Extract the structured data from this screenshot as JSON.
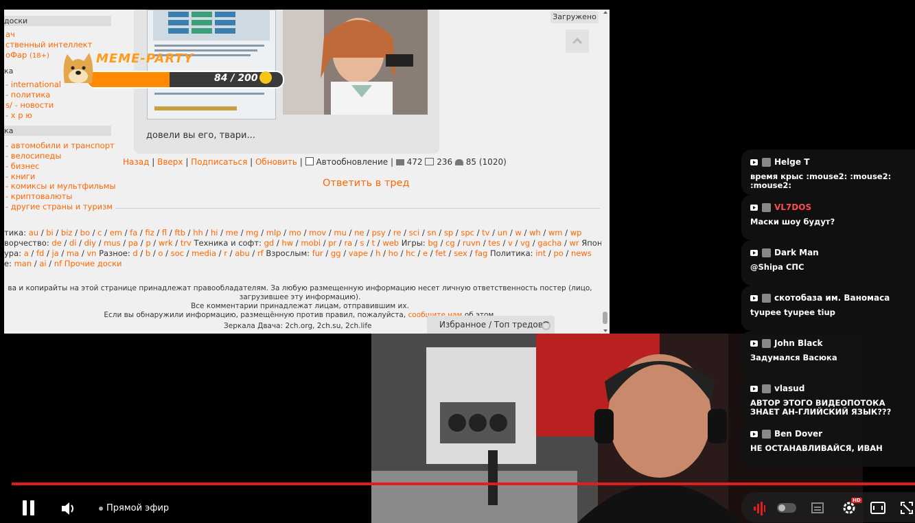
{
  "page": {
    "loaded_badge": "Загружено",
    "nav": {
      "header1": "доски",
      "items1": [
        "ач",
        "ственный интеллект",
        "оФар"
      ],
      "items1_badge": "(18+)",
      "header2": "ка",
      "items2": [
        "- international",
        "- политика",
        "s/ - новости",
        "- х р ю"
      ],
      "header3": "ка",
      "items3": [
        "- автомобили и транспорт",
        "- велосипеды",
        "- бизнес",
        "- книги",
        "- комиксы и мультфильмы",
        "- криптовалюты",
        "- другие страны и туризм"
      ]
    },
    "post_text": "довели вы его, твари...",
    "thread_nav": {
      "back": "Назад",
      "up": "Вверх",
      "subscribe": "Подписаться",
      "refresh": "Обновить",
      "autorefresh": "Автообновление",
      "posts": "472",
      "images": "236",
      "users": "85 (1020)"
    },
    "reply_link": "Ответить в тред",
    "boards": {
      "line1_prefix": "тика:",
      "line1": [
        "au",
        "bi",
        "biz",
        "bo",
        "c",
        "em",
        "fa",
        "fiz",
        "fl",
        "ftb",
        "hh",
        "hi",
        "me",
        "mg",
        "mlp",
        "mo",
        "mov",
        "mu",
        "ne",
        "psy",
        "re",
        "sci",
        "sn",
        "sp",
        "spc",
        "tv",
        "un",
        "w",
        "wh",
        "wm",
        "wp"
      ],
      "line2_prefix": "ворчество:",
      "line2a": [
        "de",
        "di",
        "diy",
        "mus",
        "pa",
        "p",
        "wrk",
        "trv"
      ],
      "line2_tech": "Техника и софт:",
      "line2b": [
        "gd",
        "hw",
        "mobi",
        "pr",
        "ra",
        "s",
        "t",
        "web"
      ],
      "line2_games": "Игры:",
      "line2c": [
        "bg",
        "cg",
        "ruvn",
        "tes",
        "v",
        "vg",
        "gacha",
        "wr"
      ],
      "line2_suffix": "Японская",
      "line3_prefix": "ура:",
      "line3a": [
        "a",
        "fd",
        "ja",
        "ma",
        "vn"
      ],
      "line3_misc": "Разное:",
      "line3b": [
        "d",
        "b",
        "o",
        "soc",
        "media",
        "r",
        "abu",
        "rf"
      ],
      "line3_adult": "Взрослым:",
      "line3c": [
        "fur",
        "gg",
        "vape",
        "h",
        "ho",
        "hc",
        "e",
        "fet",
        "sex",
        "fag"
      ],
      "line3_politics": "Политика:",
      "line3d": [
        "int",
        "po",
        "news"
      ],
      "line4_prefix": "е:",
      "line4": [
        "man",
        "ai",
        "nf"
      ],
      "line4_other": "Прочие доски"
    },
    "footer": {
      "line1": "ва и копирайты на этой странице принадлежат правообладателям. За любую размещенную информацию несет личную ответственность постер (лицо, загрузившее эту информацию).",
      "line2": "Все комментарии принадлежат лицам, отправившим их.",
      "line3_pre": "Если вы обнаружили информацию, размещённую против правил, пожалуйста,",
      "line3_link": "сообщите нам",
      "line3_post": "об этом."
    },
    "mirrors": "Зеркала Двача: 2ch.org, 2ch.su, 2ch.life",
    "fav_button": "Избранное / Топ тредов"
  },
  "meme_party": {
    "title": "MEME-PARTY",
    "progress_text": "84 / 200",
    "progress": 0.42
  },
  "chat": [
    {
      "name": "Helge T",
      "text": "время крыс :mouse2: :mouse2: :mouse2:",
      "highlight": false
    },
    {
      "name": "VL7DOS",
      "text": "Маски шоу будут?",
      "highlight": true
    },
    {
      "name": "Dark Man",
      "text": "@Shipa СПС",
      "highlight": false
    },
    {
      "name": "скотобаза им. Ваномаса",
      "text": "tyupee tyupee tiup",
      "highlight": false
    },
    {
      "name": "John Black",
      "text": "Задумался Васюка",
      "highlight": false
    },
    {
      "name": "vlasud",
      "text": "АВТОР ЭТОГО ВИДЕОПОТОКА ЗНАЕТ АН-ГЛИЙСКИЙ ЯЗЫК???",
      "highlight": false
    },
    {
      "name": "Ben Dover",
      "text": "НЕ ОСТАНАВЛИВАЙСЯ, ИВАН",
      "highlight": false
    }
  ],
  "player": {
    "live_label": "Прямой эфир",
    "hd_badge": "HD",
    "accent": "#e21d1d"
  }
}
